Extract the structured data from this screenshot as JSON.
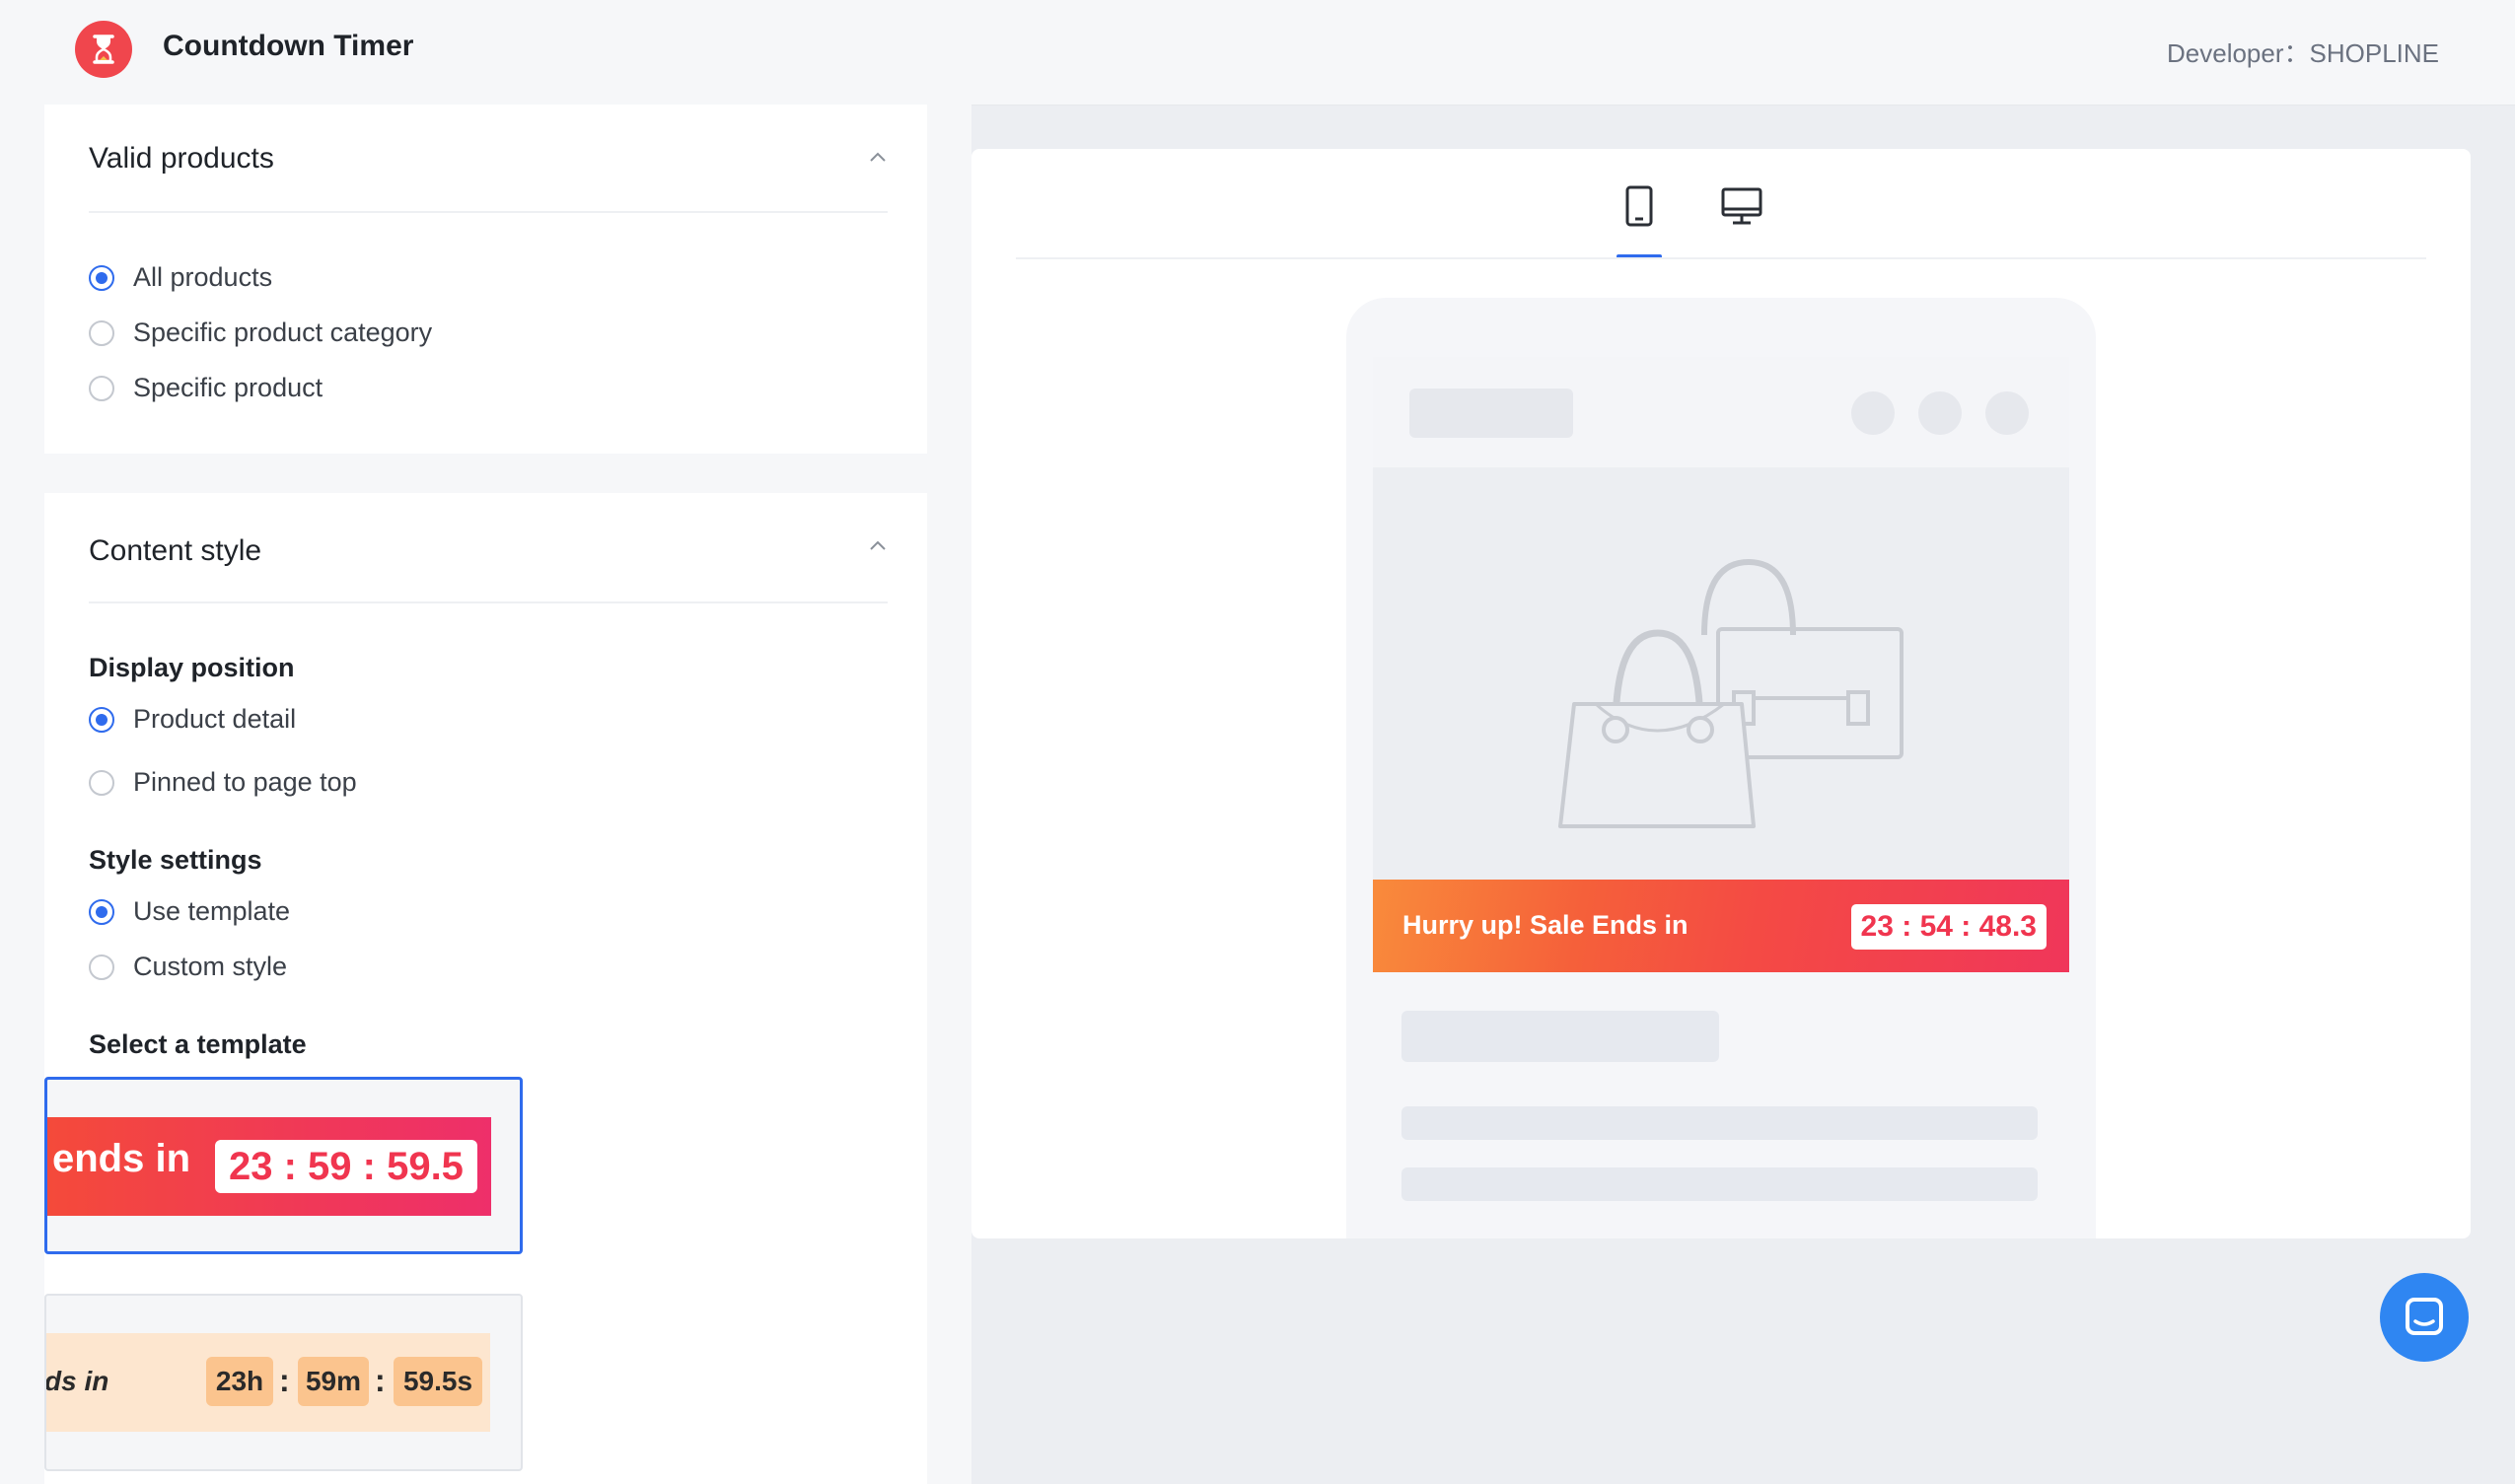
{
  "header": {
    "app_title": "Countdown Timer",
    "developer": "Developer：SHOPLINE",
    "logo_icon": "hourglass-icon"
  },
  "valid_products": {
    "title": "Valid products",
    "options": [
      {
        "label": "All products",
        "checked": true
      },
      {
        "label": "Specific product category",
        "checked": false
      },
      {
        "label": "Specific product",
        "checked": false
      }
    ]
  },
  "content_style": {
    "title": "Content style",
    "display_position": {
      "label": "Display position",
      "options": [
        {
          "label": "Product detail",
          "checked": true
        },
        {
          "label": "Pinned to page top",
          "checked": false
        }
      ]
    },
    "style_settings": {
      "label": "Style settings",
      "options": [
        {
          "label": "Use template",
          "checked": true
        },
        {
          "label": "Custom style",
          "checked": false
        }
      ]
    },
    "select_template": {
      "label": "Select a template",
      "templates": [
        {
          "text": "ends in",
          "timer": "23 : 59 : 59.5",
          "selected": true
        },
        {
          "text": "ds in",
          "hours": "23h",
          "minutes": "59m",
          "seconds": "59.5s",
          "selected": false
        }
      ]
    }
  },
  "preview": {
    "tabs": [
      {
        "icon": "mobile-icon",
        "active": true
      },
      {
        "icon": "desktop-icon",
        "active": false
      }
    ],
    "banner_text": "Hurry up! Sale Ends in",
    "banner_timer": "23 : 54 : 48.3"
  },
  "colors": {
    "accent": "#2f6bed",
    "brand": "#f0464d",
    "timer_red": "#f0354f",
    "chat_button": "#2f86f2"
  },
  "chat_icon": "chat-icon"
}
